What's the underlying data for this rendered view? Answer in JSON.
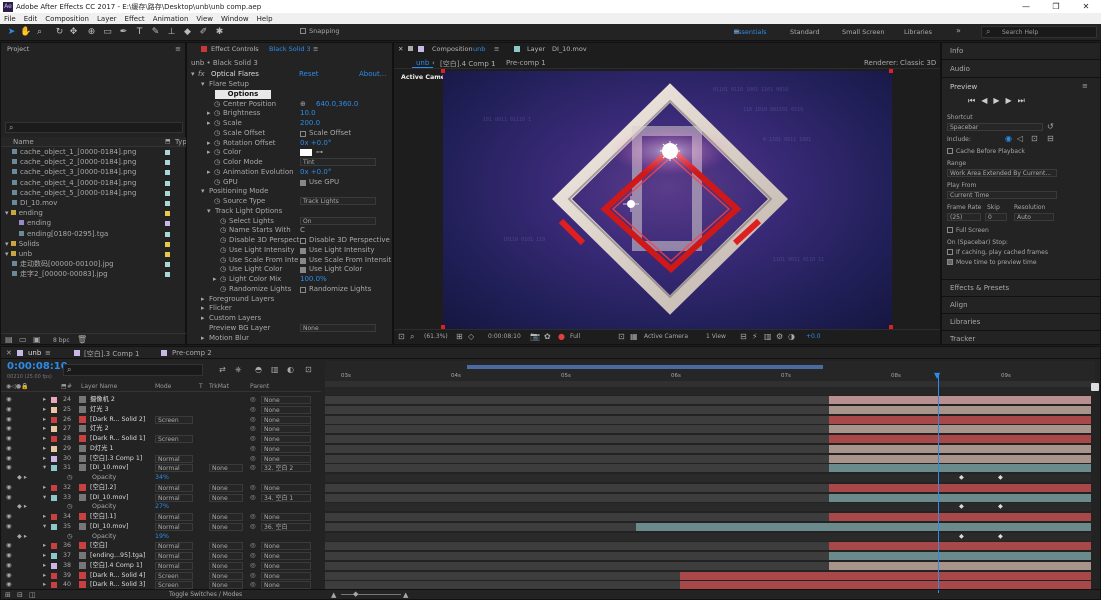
{
  "titlebar": {
    "title": "Adobe After Effects CC 2017 - E:\\缓存\\路存\\Desktop\\unb\\unb comp.aep",
    "controls": [
      "—",
      "❐",
      "✕"
    ]
  },
  "menu": [
    "File",
    "Edit",
    "Composition",
    "Layer",
    "Effect",
    "Animation",
    "View",
    "Window",
    "Help"
  ],
  "toolbar": {
    "snapping": "Snapping",
    "workspaces": [
      "Essentials",
      "Standard",
      "Small Screen",
      "Libraries"
    ],
    "search_placeholder": "Search Help"
  },
  "project": {
    "title": "Project",
    "col_name": "Name",
    "col_type": "Typ",
    "items": [
      {
        "name": "cache_object_1_[0000-0184].png",
        "color": "#a8d8d8",
        "indent": 1,
        "kind": "file"
      },
      {
        "name": "cache_object_2_[0000-0184].png",
        "color": "#a8d8d8",
        "indent": 1,
        "kind": "file"
      },
      {
        "name": "cache_object_3_[0000-0184].png",
        "color": "#a8d8d8",
        "indent": 1,
        "kind": "file"
      },
      {
        "name": "cache_object_4_[0000-0184].png",
        "color": "#a8d8d8",
        "indent": 1,
        "kind": "file"
      },
      {
        "name": "cache_object_5_[0000-0184].png",
        "color": "#a8d8d8",
        "indent": 1,
        "kind": "file"
      },
      {
        "name": "DI_10.mov",
        "color": "#a8d8d8",
        "indent": 1,
        "kind": "file"
      },
      {
        "name": "ending",
        "color": "#e8c84a",
        "indent": 0,
        "kind": "folder"
      },
      {
        "name": "ending",
        "color": "#c8b8e8",
        "indent": 2,
        "kind": "comp"
      },
      {
        "name": "ending[0180-0295].tga",
        "color": "#a8d8d8",
        "indent": 2,
        "kind": "file"
      },
      {
        "name": "Solids",
        "color": "#e8c84a",
        "indent": 0,
        "kind": "folder"
      },
      {
        "name": "unb",
        "color": "#e8c84a",
        "indent": 0,
        "kind": "folder"
      },
      {
        "name": "走动数码[00000-00100].jpg",
        "color": "#a8d8d8",
        "indent": 1,
        "kind": "file"
      },
      {
        "name": "走字2_[00000-00083].jpg",
        "color": "#a8d8d8",
        "indent": 1,
        "kind": "file"
      }
    ],
    "bpc": "8 bpc"
  },
  "effect": {
    "tab": "Effect Controls",
    "tab_target": "Black Solid 3",
    "breadcrumb": "unb • Black Solid 3",
    "fx_name": "Optical Flares",
    "reset": "Reset",
    "about": "About...",
    "rows": [
      {
        "label": "Flare Setup",
        "indent": 1,
        "exp": "▾"
      },
      {
        "label": "",
        "indent": 2,
        "button": "Options"
      },
      {
        "label": "Center Position",
        "indent": 2,
        "stop": true,
        "value": "640.0,360.0",
        "value_blue": true,
        "target": true
      },
      {
        "label": "Brightness",
        "indent": 2,
        "exp": "▸",
        "stop": true,
        "value": "10.0",
        "value_blue": true
      },
      {
        "label": "Scale",
        "indent": 2,
        "exp": "▸",
        "stop": true,
        "value": "200.0",
        "value_blue": true
      },
      {
        "label": "Scale Offset",
        "indent": 2,
        "stop": true,
        "check": "Scale Offset"
      },
      {
        "label": "Rotation Offset",
        "indent": 2,
        "exp": "▸",
        "stop": true,
        "value": "0x +0.0°",
        "value_blue": true
      },
      {
        "label": "Color",
        "indent": 2,
        "exp": "▸",
        "stop": true,
        "swatch": "#ffffff"
      },
      {
        "label": "Color Mode",
        "indent": 2,
        "stop": true,
        "dropdown": "Tint"
      },
      {
        "label": "Animation Evolution",
        "indent": 2,
        "exp": "▸",
        "stop": true,
        "value": "0x +0.0°",
        "value_blue": true
      },
      {
        "label": "GPU",
        "indent": 2,
        "stop": true,
        "check": "Use GPU",
        "checked": true
      },
      {
        "label": "Positioning Mode",
        "indent": 1,
        "exp": "▾"
      },
      {
        "label": "Source Type",
        "indent": 2,
        "stop": true,
        "dropdown": "Track Lights"
      },
      {
        "label": "Track Light Options",
        "indent": 2,
        "exp": "▾"
      },
      {
        "label": "Select Lights",
        "indent": 3,
        "stop": true,
        "dropdown": "On"
      },
      {
        "label": "Name Starts With",
        "indent": 3,
        "stop": true,
        "text": "C"
      },
      {
        "label": "Disable 3D Perspect",
        "indent": 3,
        "stop": true,
        "check": "Disable 3D Perspective"
      },
      {
        "label": "Use Light Intensity",
        "indent": 3,
        "stop": true,
        "check": "Use Light Intensity",
        "checked": true
      },
      {
        "label": "Use Scale From Inte",
        "indent": 3,
        "stop": true,
        "check": "Use Scale From Intensit",
        "checked": true
      },
      {
        "label": "Use Light Color",
        "indent": 3,
        "stop": true,
        "check": "Use Light Color",
        "checked": true
      },
      {
        "label": "Light Color Mix",
        "indent": 3,
        "exp": "▸",
        "stop": true,
        "value": "100.0%",
        "value_blue": true
      },
      {
        "label": "Randomize Lights",
        "indent": 3,
        "stop": true,
        "check": "Randomize Lights"
      },
      {
        "label": "Foreground Layers",
        "indent": 1,
        "exp": "▸"
      },
      {
        "label": "Flicker",
        "indent": 1,
        "exp": "▸"
      },
      {
        "label": "Custom Layers",
        "indent": 1,
        "exp": "▸"
      },
      {
        "label": "Preview BG Layer",
        "indent": 1,
        "dropdown": "None"
      },
      {
        "label": "Motion Blur",
        "indent": 1,
        "exp": "▸"
      }
    ]
  },
  "comp": {
    "tab1": "Composition",
    "tab1_target": "unb",
    "tab2": "Layer",
    "tab2_target": "DI_10.mov",
    "crumbs": [
      "unb",
      "[空白].4 Comp 1",
      "Pre-comp 1"
    ],
    "renderer_label": "Renderer:",
    "renderer": "Classic 3D",
    "active_camera": "Active Camera",
    "footer": {
      "zoom": "(61.3%)",
      "timecode": "0:00:08:10",
      "quality": "Full",
      "view": "Active Camera",
      "views": "1 View",
      "exposure": "+0.0"
    }
  },
  "right": {
    "info": "Info",
    "audio": "Audio",
    "preview": "Preview",
    "shortcut_label": "Shortcut",
    "shortcut": "Spacebar",
    "include_label": "Include:",
    "cache_before": "Cache Before Playback",
    "range_label": "Range",
    "range": "Work Area Extended By Current...",
    "play_from_label": "Play From",
    "play_from": "Current Time",
    "frame_rate_label": "Frame Rate",
    "skip_label": "Skip",
    "resolution_label": "Resolution",
    "frame_rate": "(25)",
    "skip": "0",
    "resolution": "Auto",
    "full_screen": "Full Screen",
    "on_stop": "On (Spacebar) Stop:",
    "if_caching": "If caching, play cached frames",
    "move_time": "Move time to preview time",
    "sections": [
      "Effects & Presets",
      "Align",
      "Libraries",
      "Tracker"
    ]
  },
  "timeline": {
    "tabs": [
      "unb",
      "[空白].3 Comp 1",
      "Pre-comp 2"
    ],
    "timecode": "0:00:08:10",
    "frames": "00210 (25.00 fps)",
    "col_layer": "Layer Name",
    "col_mode": "Mode",
    "col_t": "T",
    "col_trkmat": "TrkMat",
    "col_parent": "Parent",
    "ruler": [
      "03s",
      "04s",
      "05s",
      "06s",
      "07s",
      "08s",
      "09s"
    ],
    "toggle": "Toggle Switches / Modes",
    "layers": [
      {
        "num": "24",
        "name": "摄像机 2",
        "color": "#e8a8b8",
        "icon": "cam",
        "mode": "",
        "trk": "",
        "parent": "None",
        "bar": "pink",
        "start": 828
      },
      {
        "num": "25",
        "name": "灯光 3",
        "color": "#e8c8a0",
        "icon": "light",
        "mode": "",
        "trk": "",
        "parent": "None",
        "bar": "tan",
        "start": 828
      },
      {
        "num": "26",
        "name": "[Dark R... Solid 2]",
        "color": "#c84040",
        "icon": "solid",
        "mode": "Screen",
        "trk": "",
        "parent": "None",
        "bar": "red",
        "start": 828
      },
      {
        "num": "27",
        "name": "灯光 2",
        "color": "#e8c8a0",
        "icon": "light",
        "mode": "",
        "trk": "",
        "parent": "None",
        "bar": "tan",
        "start": 828
      },
      {
        "num": "28",
        "name": "[Dark R... Solid 1]",
        "color": "#c84040",
        "icon": "solid",
        "mode": "Screen",
        "trk": "",
        "parent": "None",
        "bar": "red",
        "start": 828
      },
      {
        "num": "29",
        "name": "D灯光 1",
        "color": "#e8c8a0",
        "icon": "light",
        "mode": "",
        "trk": "",
        "parent": "None",
        "bar": "tan",
        "start": 828
      },
      {
        "num": "30",
        "name": "[空白].3 Comp 1]",
        "color": "#c8b8e8",
        "icon": "comp",
        "mode": "Normal",
        "trk": "",
        "parent": "None",
        "bar": "tan",
        "start": 828
      },
      {
        "num": "31",
        "name": "[DI_10.mov]",
        "color": "#8cc8c8",
        "icon": "file",
        "mode": "Normal",
        "trk": "None",
        "parent": "32. 空白 2",
        "bar": "teal",
        "start": 828,
        "open": true
      },
      {
        "sub": "Opacity",
        "value": "34%"
      },
      {
        "num": "32",
        "name": "[空白].2]",
        "color": "#c84040",
        "icon": "solid",
        "mode": "Normal",
        "trk": "None",
        "parent": "None",
        "bar": "red",
        "start": 828
      },
      {
        "num": "33",
        "name": "[DI_10.mov]",
        "color": "#8cc8c8",
        "icon": "file",
        "mode": "Normal",
        "trk": "None",
        "parent": "34. 空白 1",
        "bar": "teal",
        "start": 828,
        "open": true
      },
      {
        "sub": "Opacity",
        "value": "27%"
      },
      {
        "num": "34",
        "name": "[空白].1]",
        "color": "#c84040",
        "icon": "solid",
        "mode": "Normal",
        "trk": "None",
        "parent": "None",
        "bar": "red",
        "start": 828
      },
      {
        "num": "35",
        "name": "[DI_10.mov]",
        "color": "#8cc8c8",
        "icon": "file",
        "mode": "Normal",
        "trk": "None",
        "parent": "36. 空白",
        "bar": "teal",
        "start": 635,
        "open": true
      },
      {
        "sub": "Opacity",
        "value": "19%"
      },
      {
        "num": "36",
        "name": "[空白]",
        "color": "#c84040",
        "icon": "solid",
        "mode": "Normal",
        "trk": "None",
        "parent": "None",
        "bar": "red",
        "start": 828
      },
      {
        "num": "37",
        "name": "[ending...95].tga]",
        "color": "#8cc8c8",
        "icon": "file",
        "mode": "Normal",
        "trk": "None",
        "parent": "None",
        "bar": "teal",
        "start": 828
      },
      {
        "num": "38",
        "name": "[空白].4 Comp 1]",
        "color": "#c8b8e8",
        "icon": "comp",
        "mode": "Normal",
        "trk": "None",
        "parent": "None",
        "bar": "tan",
        "start": 828
      },
      {
        "num": "39",
        "name": "[Dark R... Solid 4]",
        "color": "#c84040",
        "icon": "solid",
        "mode": "Screen",
        "trk": "None",
        "parent": "None",
        "bar": "red",
        "start": 679
      },
      {
        "num": "40",
        "name": "[Dark R... Solid 3]",
        "color": "#c84040",
        "icon": "solid",
        "mode": "Screen",
        "trk": "None",
        "parent": "None",
        "bar": "red",
        "start": 679
      }
    ]
  }
}
